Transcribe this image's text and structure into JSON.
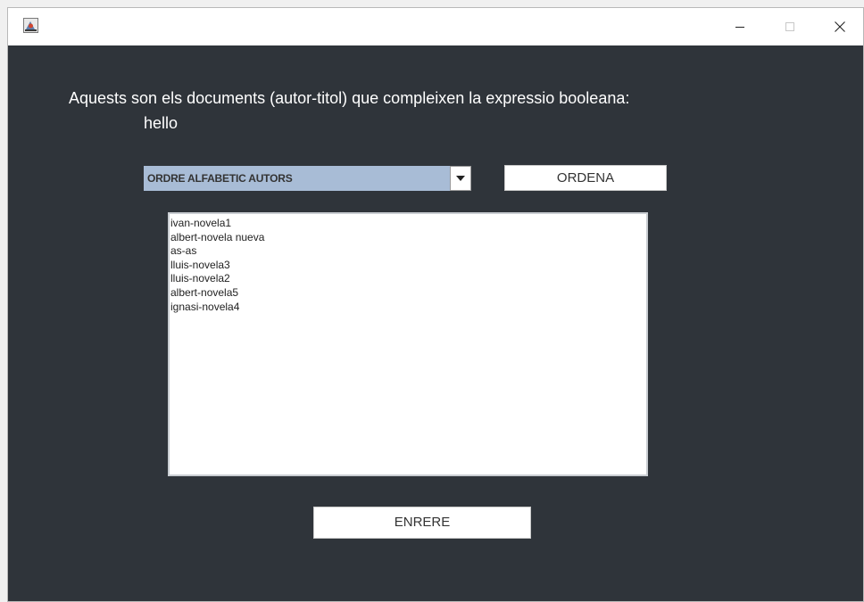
{
  "window": {
    "title": "",
    "controls": {
      "minimize_icon": "minimize-icon",
      "maximize_icon": "maximize-icon",
      "close_icon": "close-icon"
    }
  },
  "main": {
    "heading_line1": "Aquests son els documents (autor-titol) que compleixen la expressio booleana:",
    "heading_line2": "hello",
    "sort_select": {
      "selected": "ORDRE ALFABETIC AUTORS"
    },
    "sort_button_label": "ORDENA",
    "documents": [
      "ivan-novela1",
      "albert-novela nueva",
      "as-as",
      "lluis-novela3",
      "lluis-novela2",
      "albert-novela5",
      "ignasi-novela4"
    ],
    "back_button_label": "ENRERE"
  },
  "colors": {
    "background": "#2f343a",
    "combo_selected": "#a8bcd6",
    "text_light": "#ffffff"
  }
}
